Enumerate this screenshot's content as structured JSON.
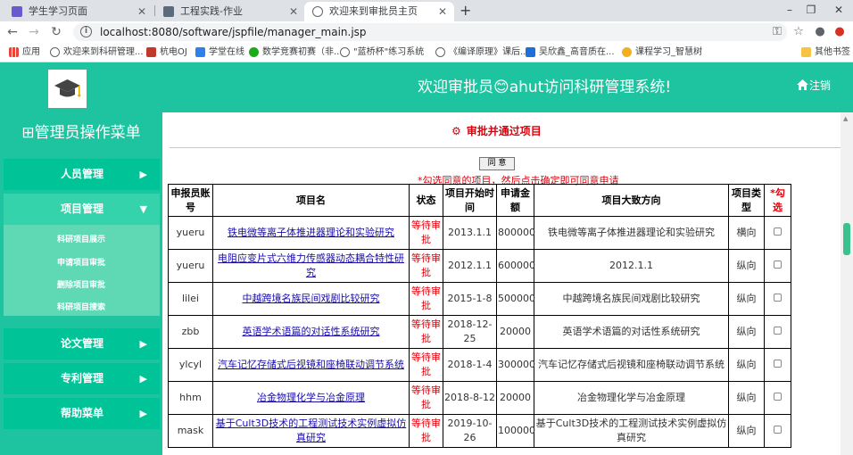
{
  "browser": {
    "tabs": [
      {
        "title": "学生学习页面",
        "active": false
      },
      {
        "title": "工程实践-作业",
        "active": false
      },
      {
        "title": "欢迎来到审批员主页",
        "active": true
      }
    ],
    "new_tab": "+",
    "window_controls": [
      "–",
      "❐",
      "✕"
    ],
    "url": "localhost:8080/software/jspfile/manager_main.jsp",
    "bookmarks": [
      {
        "label": "应用"
      },
      {
        "label": "欢迎来到科研管理..."
      },
      {
        "label": "杭电OJ"
      },
      {
        "label": "学堂在线"
      },
      {
        "label": "数学竞赛初赛（非..."
      },
      {
        "label": "\"蓝桥杯\"练习系统"
      },
      {
        "label": "《编译原理》课后..."
      },
      {
        "label": "吴欣鑫_高音质在..."
      },
      {
        "label": "课程学习_智慧树"
      },
      {
        "label": "其他书签"
      }
    ]
  },
  "header": {
    "welcome": "欢迎审批员😊ahut访问科研管理系统!",
    "logout": "注销"
  },
  "sidebar": {
    "title": "⊞管理员操作菜单",
    "menu": [
      {
        "label": "人员管理",
        "arrow": "▶"
      },
      {
        "label": "项目管理",
        "arrow": "▼"
      },
      {
        "label": "论文管理",
        "arrow": "▶"
      },
      {
        "label": "专利管理",
        "arrow": "▶"
      },
      {
        "label": "帮助菜单",
        "arrow": "▶"
      }
    ],
    "submenu": [
      "科研项目展示",
      "申请项目审批",
      "删除项目审批",
      "科研项目搜索"
    ]
  },
  "content": {
    "heading_icon": "⚙",
    "heading": "审批并通过项目",
    "agree_button": "同 意",
    "hint": "*勾选同意的项目，然后点击确定即可同意申请",
    "columns": [
      "申报员账号",
      "项目名",
      "状态",
      "项目开始时间",
      "申请金额",
      "项目大致方向",
      "项目类型",
      "*勾选"
    ],
    "rows": [
      {
        "account": "yueru",
        "name": "铁电微等离子体推进器理论和实验研究",
        "status": "等待审批",
        "start": "2013.1.1",
        "amount": "800000",
        "direction": "铁电微等离子体推进器理论和实验研究",
        "type": "横向"
      },
      {
        "account": "yueru",
        "name": "电阻应变片式六维力传感器动态耦合特性研究",
        "status": "等待审批",
        "start": "2012.1.1",
        "amount": "600000",
        "direction": "2012.1.1",
        "type": "纵向"
      },
      {
        "account": "lilei",
        "name": "中越跨境名族民间戏剧比较研究",
        "status": "等待审批",
        "start": "2015-1-8",
        "amount": "500000",
        "direction": "中越跨境名族民间戏剧比较研究",
        "type": "纵向"
      },
      {
        "account": "zbb",
        "name": "英语学术语篇的对话性系统研究",
        "status": "等待审批",
        "start": "2018-12-25",
        "amount": "20000",
        "direction": "英语学术语篇的对话性系统研究",
        "type": "纵向"
      },
      {
        "account": "ylcyl",
        "name": "汽车记忆存储式后视镜和座椅联动调节系统",
        "status": "等待审批",
        "start": "2018-1-4",
        "amount": "300000",
        "direction": "汽车记忆存储式后视镜和座椅联动调节系统",
        "type": "纵向"
      },
      {
        "account": "hhm",
        "name": "冶金物理化学与冶金原理",
        "status": "等待审批",
        "start": "2018-8-12",
        "amount": "20000",
        "direction": "冶金物理化学与冶金原理",
        "type": "纵向"
      },
      {
        "account": "mask",
        "name": "基于Cult3D技术的工程测试技术实例虚拟仿真研究",
        "status": "等待审批",
        "start": "2019-10-26",
        "amount": "100000",
        "direction": "基于Cult3D技术的工程测试技术实例虚拟仿真研究",
        "type": "纵向"
      }
    ]
  },
  "colors": {
    "header_green": "#1ec4a0",
    "menu_green": "#00c497",
    "submenu_green": "#5fd9b4",
    "alert_red": "#e0000b",
    "link_blue": "#1a0dab"
  }
}
